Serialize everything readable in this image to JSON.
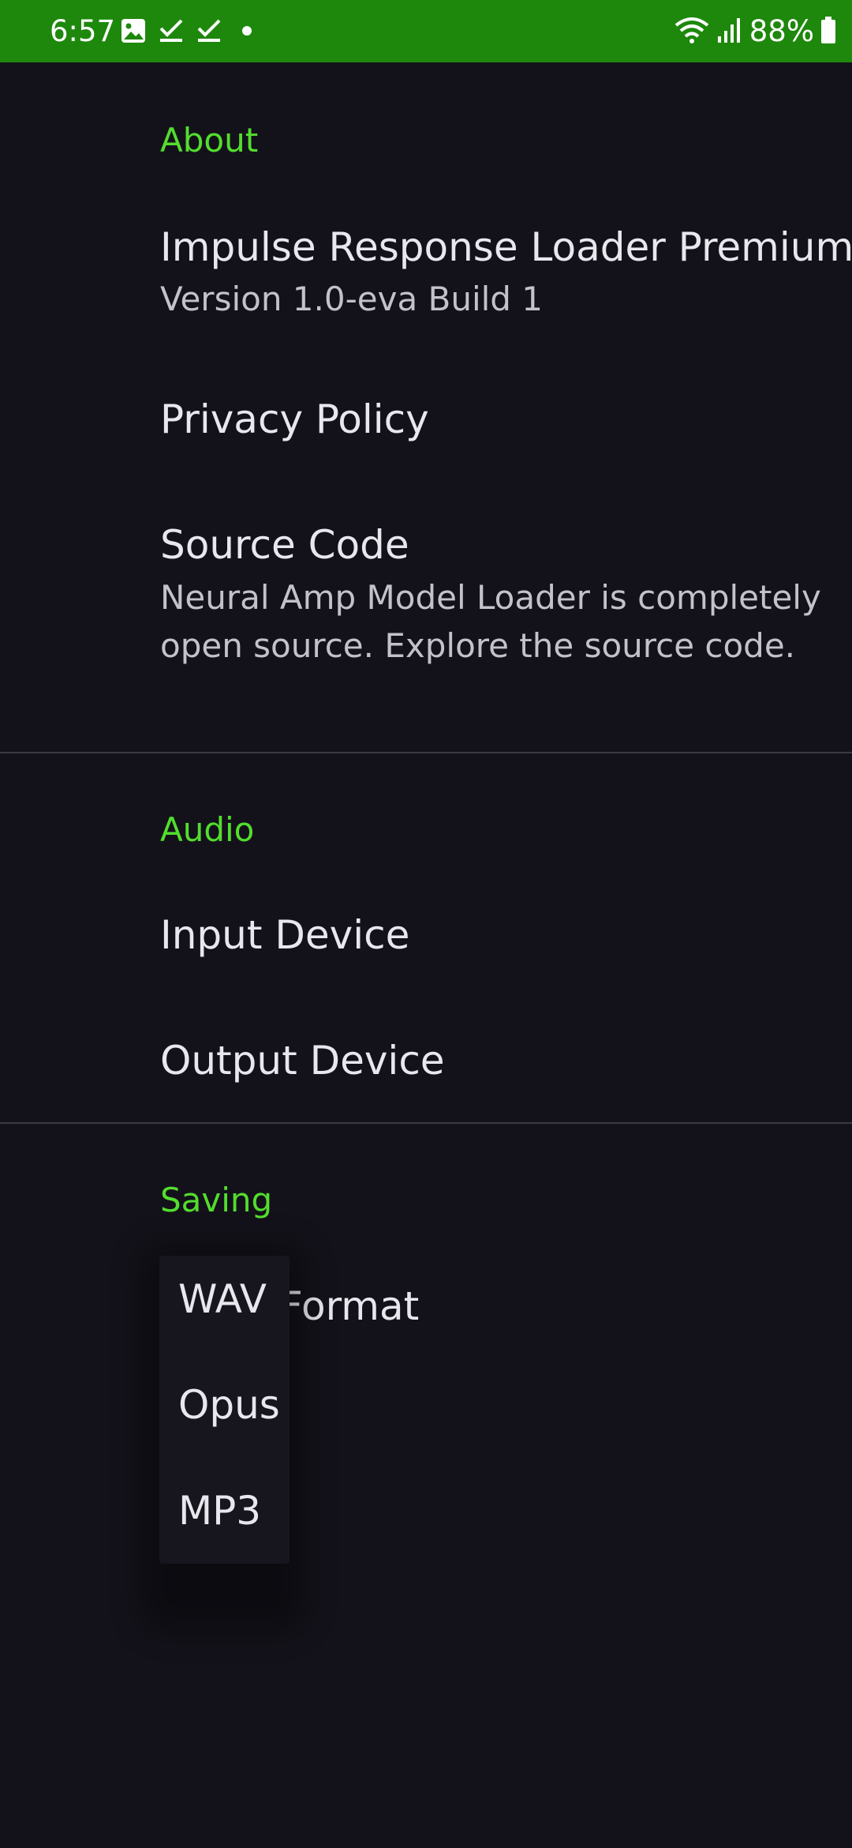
{
  "status_bar": {
    "time": "6:57",
    "battery": "88%",
    "left_icons": [
      "gallery-icon",
      "check-icon",
      "check-icon",
      "dot-icon"
    ],
    "right_icons": [
      "wifi-icon",
      "signal-icon",
      "battery-icon"
    ],
    "color": "#1e880c"
  },
  "sections": {
    "about": {
      "header": "About",
      "app_name": "Impulse Response Loader Premium",
      "version": "Version 1.0-eva Build 1",
      "privacy": "Privacy Policy",
      "source_title": "Source Code",
      "source_summary": "Neural Amp Model Loader is completely open source. Explore the source code."
    },
    "audio": {
      "header": "Audio",
      "input": "Input Device",
      "output": "Output Device"
    },
    "saving": {
      "header": "Saving",
      "format_visible": "Format"
    }
  },
  "dropdown": {
    "options": [
      "WAV",
      "Opus",
      "MP3"
    ]
  },
  "colors": {
    "accent": "#53dd2e",
    "background": "#13121a"
  }
}
